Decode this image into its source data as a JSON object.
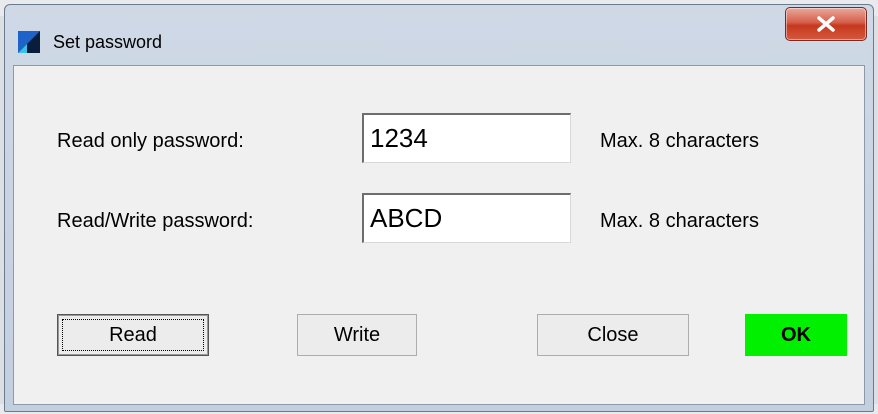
{
  "window": {
    "title": "Set password",
    "close_glyph": "X"
  },
  "fields": {
    "read_only": {
      "label": "Read only password:",
      "value": "1234",
      "hint": "Max. 8 characters"
    },
    "read_write": {
      "label": "Read/Write password:",
      "value": "ABCD",
      "hint": "Max. 8 characters"
    }
  },
  "buttons": {
    "read": "Read",
    "write": "Write",
    "close": "Close",
    "ok": "OK"
  },
  "colors": {
    "ok_background": "#00f000",
    "close_button": "#c6381f"
  },
  "icons": {
    "app": "app-icon",
    "close": "close-x-icon"
  }
}
